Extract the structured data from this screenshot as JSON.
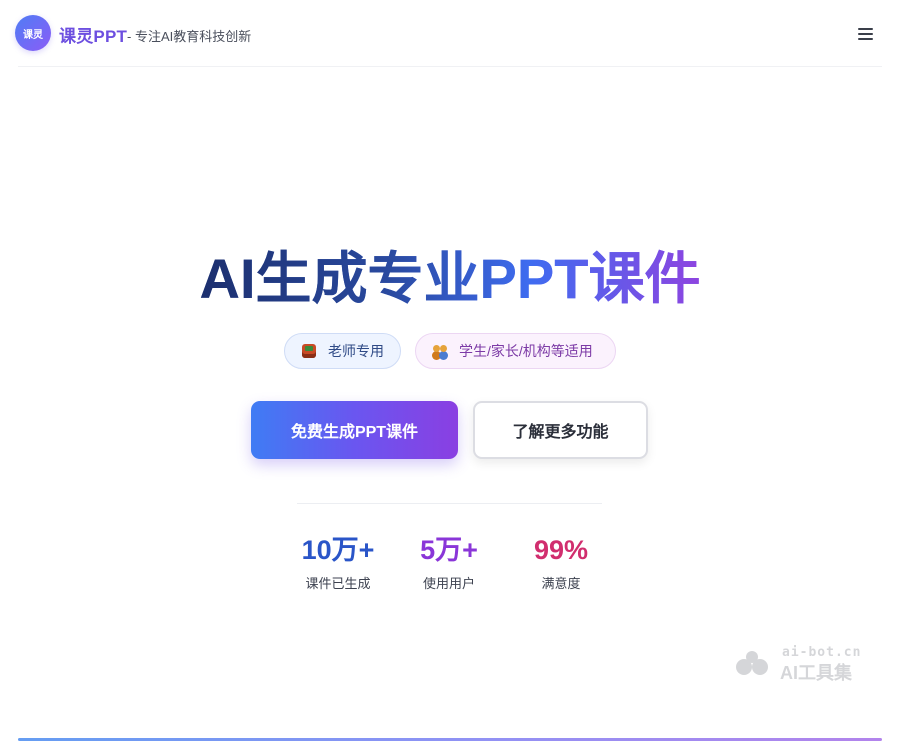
{
  "header": {
    "logo_text": "课灵",
    "brand_name": "课灵PPT",
    "tagline": "- 专注AI教育科技创新",
    "menu_icon": "hamburger-menu-icon"
  },
  "hero": {
    "title": "AI生成专业PPT课件",
    "tags": [
      {
        "label": "老师专用",
        "icon": "books-icon"
      },
      {
        "label": "学生/家长/机构等适用",
        "icon": "people-icon"
      }
    ],
    "primary_button": "免费生成PPT课件",
    "secondary_button": "了解更多功能"
  },
  "stats": [
    {
      "value": "10万+",
      "label": "课件已生成",
      "color": "#2a55c8"
    },
    {
      "value": "5万+",
      "label": "使用用户",
      "color": "#8a36d8"
    },
    {
      "value": "99%",
      "label": "满意度",
      "color": "#d12e6e"
    }
  ],
  "watermark": {
    "domain": "ai-bot.cn",
    "name": "AI工具集"
  },
  "colors": {
    "brand_purple": "#6d4fe0",
    "gradient_start": "#3f7cf4",
    "gradient_end": "#8a3fe2"
  }
}
